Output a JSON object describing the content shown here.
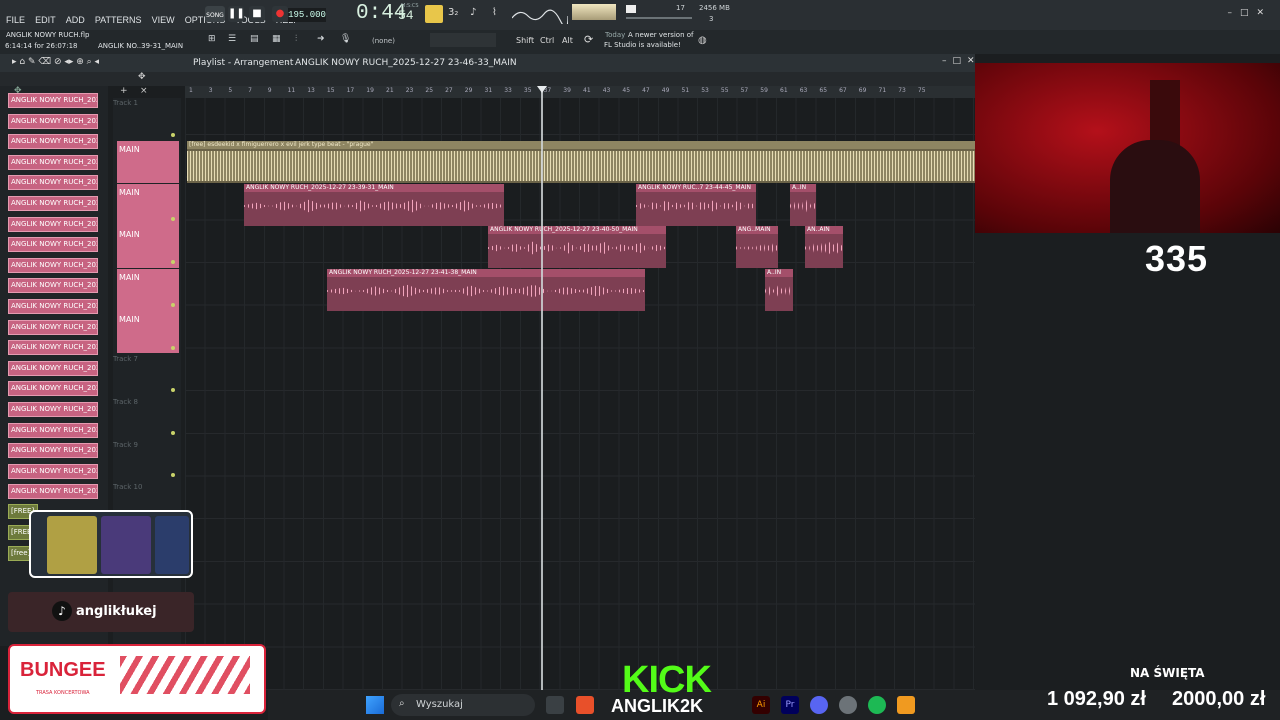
{
  "menu": [
    "FILE",
    "EDIT",
    "ADD",
    "PATTERNS",
    "VIEW",
    "OPTIONS",
    "TOOLS",
    "HELP"
  ],
  "transport": {
    "song_label": "SONG",
    "bpm": "195.000",
    "time_main": "0:44",
    "time_sub": "54",
    "time_label": "M:S:CS"
  },
  "resources": {
    "cpu": "17",
    "memory": "2456 MB",
    "poly": "3"
  },
  "project": {
    "file": "ANGLIK NOWY RUCH.flp",
    "time": "6:14:14 for 26:07:18",
    "pattern": "ANGLIK NO..39-31_MAIN"
  },
  "toolbar2": {
    "none_label": "(none)",
    "shift": "Shift",
    "ctrl": "Ctrl",
    "alt": "Alt",
    "notice_day": "Today",
    "notice_line1": "A newer version of",
    "notice_line2": "FL Studio is available!"
  },
  "playlist": {
    "title": "Playlist - Arrangement",
    "pattern": "ANGLIK NOWY RUCH_2025-12-27 23-46-33_MAIN"
  },
  "ruler": [
    "1",
    "3",
    "5",
    "7",
    "9",
    "11",
    "13",
    "15",
    "17",
    "19",
    "21",
    "23",
    "25",
    "27",
    "29",
    "31",
    "33",
    "35",
    "37",
    "39",
    "41",
    "43",
    "45",
    "47",
    "49",
    "51",
    "53",
    "55",
    "57",
    "59",
    "61",
    "63",
    "65",
    "67",
    "69",
    "71",
    "73",
    "75"
  ],
  "picker": [
    "ANGLIK NOWY RUCH_2025...",
    "ANGLIK NOWY RUCH_2025...",
    "ANGLIK NOWY RUCH_2025...",
    "ANGLIK NOWY RUCH_2025...",
    "ANGLIK NOWY RUCH_2025...",
    "ANGLIK NOWY RUCH_2025...",
    "ANGLIK NOWY RUCH_2025...",
    "ANGLIK NOWY RUCH_2025...",
    "ANGLIK NOWY RUCH_2025...",
    "ANGLIK NOWY RUCH_2025...",
    "ANGLIK NOWY RUCH_2025...",
    "ANGLIK NOWY RUCH_2025...",
    "ANGLIK NOWY RUCH_2025...",
    "ANGLIK NOWY RUCH_2025...",
    "ANGLIK NOWY RUCH_2025...",
    "ANGLIK NOWY RUCH_2025...",
    "ANGLIK NOWY RUCH_2025...",
    "ANGLIK NOWY RUCH_2025...",
    "ANGLIK NOWY RUCH_2025...",
    "ANGLIK NOWY RUCH_2025..."
  ],
  "picker_free": [
    "[FREE]",
    "[FREE]",
    "[free]"
  ],
  "tracks": {
    "t1": "Track 1",
    "t7": "Track 7",
    "t8": "Track 8",
    "t9": "Track 9",
    "t10": "Track 10",
    "main": "MAIN"
  },
  "clips": {
    "beat": "[free] esdeekid x fimiguerrero x evil jerk type beat - \"prague\"",
    "c1": "ANGLIK NOWY RUCH_2025-12-27 23-39-31_MAIN",
    "c2": "ANGLIK NOWY RUC..7 23-44-45_MAIN",
    "c3": "A..IN",
    "c4": "ANGLIK NOWY RUCH_2025-12-27 23-40-50_MAIN",
    "c5": "ANG..MAIN",
    "c6": "AN..AIN",
    "c7": "ANGLIK NOWY RUCH_2025-12-27 23-41-38_MAIN",
    "c8": "A..IN"
  },
  "overlay": {
    "count": "335",
    "tiktok": "anglikłukej",
    "bungee": "BUNGEE",
    "bungee_sub": "TRASA KONCERTOWA",
    "kick": "KICK",
    "kick_name": "ANGLIK2K",
    "goal_title": "NA ŚWIĘTA",
    "goal_current": "1 092,90 zł",
    "goal_target": "2000,00 zł"
  },
  "taskbar": {
    "search": "Wyszukaj"
  },
  "colors": {
    "clip_pink": "#c76381",
    "beat_clip": "#8e8562",
    "kick_green": "#53fc18",
    "bungee_red": "#d9233a"
  }
}
